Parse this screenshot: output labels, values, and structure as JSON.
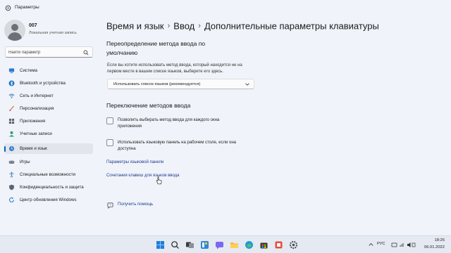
{
  "window": {
    "title": "Параметры"
  },
  "user": {
    "name": "007",
    "subtitle": "Локальная учетная запись"
  },
  "search": {
    "placeholder": "Найти параметр"
  },
  "sidebar": {
    "items": [
      {
        "label": "Система",
        "icon": "display-icon"
      },
      {
        "label": "Bluetooth и устройства",
        "icon": "bluetooth-icon"
      },
      {
        "label": "Сеть и Интернет",
        "icon": "wifi-icon"
      },
      {
        "label": "Персонализация",
        "icon": "brush-icon"
      },
      {
        "label": "Приложения",
        "icon": "apps-icon"
      },
      {
        "label": "Учетные записи",
        "icon": "person-icon"
      },
      {
        "label": "Время и язык",
        "icon": "globe-clock-icon",
        "active": true
      },
      {
        "label": "Игры",
        "icon": "gamepad-icon"
      },
      {
        "label": "Специальные возможности",
        "icon": "accessibility-icon"
      },
      {
        "label": "Конфиденциальность и защита",
        "icon": "shield-icon"
      },
      {
        "label": "Центр обновления Windows",
        "icon": "update-icon"
      }
    ]
  },
  "breadcrumb": {
    "level1": "Время и язык",
    "level2": "Ввод",
    "current": "Дополнительные параметры клавиатуры",
    "separator": "›"
  },
  "override": {
    "title_line1": "Переопределение метода ввода по",
    "title_line2": "умолчанию",
    "desc_line1": "Если вы хотите использовать метод ввода, который находится не на",
    "desc_line2": "первом месте в вашем списке языков, выберите его здесь.",
    "selected": "Использовать список языков (рекомендуется)"
  },
  "switching": {
    "title": "Переключение методов ввода",
    "option1_line1": "Позволить выбирать метод ввода для каждого окна",
    "option1_line2": "приложения",
    "option1_checked": false,
    "option2_line1": "Использовать языковую панель на рабочем столе, если она",
    "option2_line2": "доступна",
    "option2_checked": false
  },
  "links": {
    "language_bar": "Параметры языковой панели",
    "hotkeys": "Сочетания клавиш для языков ввода",
    "help": "Получить помощь"
  },
  "taskbar": {
    "lang": "РУС",
    "time": "18:26",
    "date": "06.01.2022"
  },
  "colors": {
    "accent": "#005fb8",
    "link": "#1d3f8f",
    "background": "#f0f3f9"
  }
}
